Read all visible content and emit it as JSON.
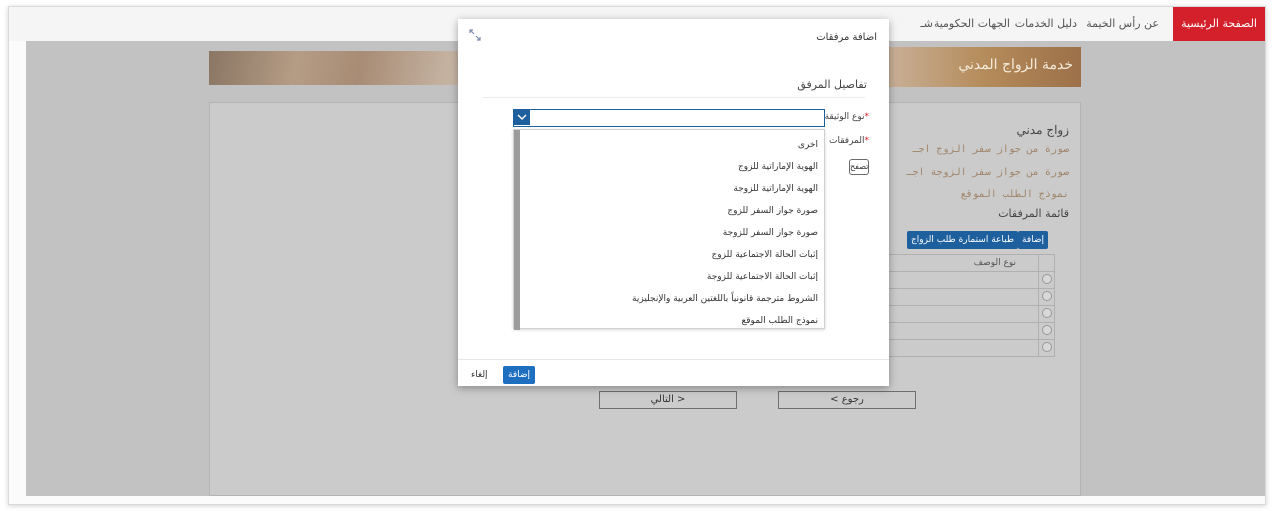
{
  "nav": {
    "items": [
      {
        "label": "الصفحة الرئيسية",
        "active": true
      },
      {
        "label": "عن رأس الخيمة"
      },
      {
        "label": "دليل الخدمات"
      },
      {
        "label": "الجهات الحكومية"
      },
      {
        "label": "شـ"
      }
    ]
  },
  "page": {
    "hero_title": "خدمة الزواج المدني",
    "section_title": "زواج مدني",
    "requirements": [
      "صورة من جواز سفر الزوج اجـ",
      "صورة من جواز سفر الزوجة اجـ",
      "نموذج الطلب الموقع"
    ],
    "attachments_title": "قائمة المرفقات",
    "add_label": "إضافة",
    "print_label": "طباعة استمارة طلب الزواج",
    "table_header": "نوع الوصف",
    "back_label": "رجوع",
    "next_label": "التالي"
  },
  "modal": {
    "title": "اضافة مرفقات",
    "subtitle": "تفاصيل المرفق",
    "doc_type_label": "نوع الوثيقة",
    "attachments_label": "المرفقات",
    "browse_label": "تصفح",
    "doc_type_value": "",
    "options": [
      "اخرى",
      "الهوية الإماراتية للزوج",
      "الهوية الإماراتية للزوجة",
      "صورة جواز السفر للزوج",
      "صورة جواز السفر للزوجة",
      "إثبات الحالة الاجتماعية للزوج",
      "إثبات الحالة الاجتماعية للزوجة",
      "الشروط مترجمة قانونياً باللغتين العربية والإنجليزية",
      "نموذج الطلب الموقع"
    ],
    "add_button": "إضافة",
    "cancel_button": "إلغاء"
  },
  "colors": {
    "accent": "#1e5f9e",
    "nav_active": "#d4202b"
  }
}
